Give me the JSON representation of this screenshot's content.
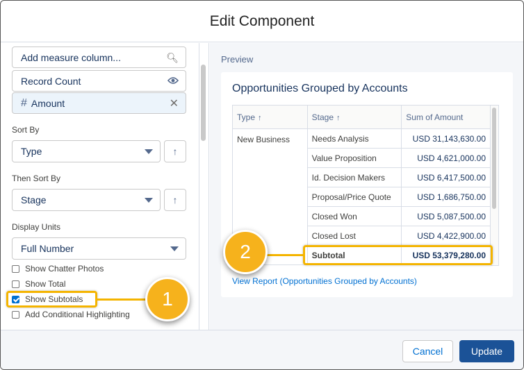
{
  "dialog": {
    "title": "Edit Component"
  },
  "left": {
    "add_measure_placeholder": "Add measure column...",
    "measures": [
      {
        "label": "Record Count",
        "icon": "eye-icon"
      },
      {
        "label": "Amount",
        "prefix": "#",
        "icon": "close-icon"
      }
    ],
    "sort_by_label": "Sort By",
    "sort_by_value": "Type",
    "then_sort_by_label": "Then Sort By",
    "then_sort_by_value": "Stage",
    "display_units_label": "Display Units",
    "display_units_value": "Full Number",
    "checkboxes": [
      {
        "label": "Show Chatter Photos",
        "checked": false
      },
      {
        "label": "Show Total",
        "checked": false
      },
      {
        "label": "Show Subtotals",
        "checked": true
      },
      {
        "label": "Add Conditional Highlighting",
        "checked": false
      }
    ]
  },
  "preview": {
    "label": "Preview",
    "card_title": "Opportunities Grouped by Accounts",
    "columns": [
      "Type",
      "Stage",
      "Sum of Amount"
    ],
    "group_type": "New Business",
    "rows": [
      {
        "stage": "Needs Analysis",
        "amount": "USD 31,143,630.00"
      },
      {
        "stage": "Value Proposition",
        "amount": "USD 4,621,000.00"
      },
      {
        "stage": "Id. Decision Makers",
        "amount": "USD 6,417,500.00"
      },
      {
        "stage": "Proposal/Price Quote",
        "amount": "USD 1,686,750.00"
      },
      {
        "stage": "Closed Won",
        "amount": "USD 5,087,500.00"
      },
      {
        "stage": "Closed Lost",
        "amount": "USD 4,422,900.00"
      }
    ],
    "subtotal": {
      "label": "Subtotal",
      "amount": "USD 53,379,280.00"
    },
    "view_report": "View Report (Opportunities Grouped by Accounts)"
  },
  "footer": {
    "cancel": "Cancel",
    "update": "Update"
  },
  "callouts": [
    "1",
    "2"
  ],
  "colors": {
    "highlight": "#f4b400",
    "callout": "#f6b21c",
    "update_button": "#1b5297",
    "link": "#0070d2"
  }
}
